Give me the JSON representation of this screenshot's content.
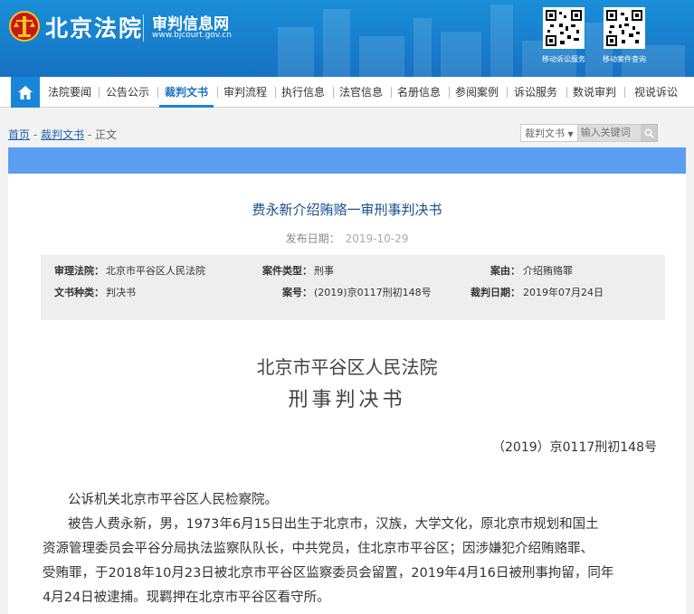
{
  "header": {
    "brand": "北京法院",
    "sub_title": "审判信息网",
    "url": "www.bjcourt.gov.cn",
    "qr_codes": [
      {
        "label": "移动诉讼服务"
      },
      {
        "label": "移动案件查询"
      }
    ],
    "colors": {
      "primary": "#1572c2",
      "nav_active": "#1a86d8"
    }
  },
  "nav": {
    "home_icon": "home-icon",
    "items": [
      {
        "label": "法院要闻"
      },
      {
        "label": "公告公示"
      },
      {
        "label": "裁判文书",
        "active": true
      },
      {
        "label": "审判流程"
      },
      {
        "label": "执行信息"
      },
      {
        "label": "法官信息"
      },
      {
        "label": "名册信息"
      },
      {
        "label": "参阅案例"
      },
      {
        "label": "诉讼服务"
      },
      {
        "label": "数说审判"
      },
      {
        "label": "视说诉讼"
      }
    ]
  },
  "breadcrumb": {
    "home": "首页",
    "sep1": "-",
    "section": "裁判文书",
    "sep2": "-",
    "current": "正文"
  },
  "search": {
    "category": "裁判文书",
    "placeholder": "输入关键词"
  },
  "document": {
    "title": "费永新介绍贿赂一审刑事判决书",
    "publish_label": "发布日期：",
    "publish_date": "2019-10-29",
    "info": {
      "court_label": "审理法院：",
      "court_value": "北京市平谷区人民法院",
      "case_type_label": "案件类型：",
      "case_type_value": "刑事",
      "cause_label": "案由：",
      "cause_value": "介绍贿赂罪",
      "doc_type_label": "文书种类：",
      "doc_type_value": "判决书",
      "case_no_label": "案号：",
      "case_no_value": "(2019)京0117刑初148号",
      "judge_date_label": "裁判日期：",
      "judge_date_value": "2019年07月24日"
    },
    "court_name": "北京市平谷区人民法院",
    "judgment_title": "刑事判决书",
    "case_number": "（2019）京0117刑初148号",
    "paragraphs": {
      "p1": "公诉机关北京市平谷区人民检察院。",
      "p2_l1": "被告人费永新，男，1973年6月15日出生于北京市，汉族，大学文化，原北京市规划和国土",
      "p2_l2": "资源管理委员会平谷分局执法监察队队长，中共党员，住北京市平谷区；因涉嫌犯介绍贿赂罪、",
      "p2_l3": "受贿罪，于2018年10月23日被北京市平谷区监察委员会留置，2019年4月16日被刑事拘留，同年",
      "p2_l4": "4月24日被逮捕。现羁押在北京市平谷区看守所。"
    }
  }
}
